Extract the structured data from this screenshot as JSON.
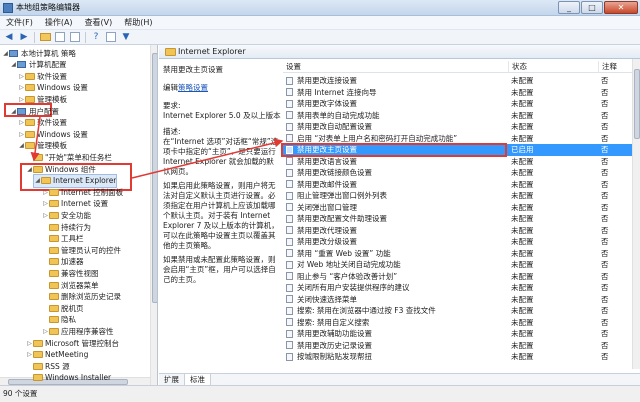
{
  "window": {
    "title": "本地组策略编辑器",
    "btn_min": "_",
    "btn_max": "□",
    "btn_close": "✕"
  },
  "menu": [
    "文件(F)",
    "操作(A)",
    "查看(V)",
    "帮助(H)"
  ],
  "toolbar_icons": [
    "back-arrow-icon",
    "forward-arrow-icon",
    "folder-icon",
    "view-icon",
    "properties-icon",
    "help-icon",
    "export-icon",
    "filter-icon"
  ],
  "tree": [
    {
      "label": "本地计算机 策略",
      "indent": 0,
      "twisty": "◢",
      "icon": "pc"
    },
    {
      "label": "计算机配置",
      "indent": 1,
      "twisty": "◢",
      "icon": "pc"
    },
    {
      "label": "软件设置",
      "indent": 2,
      "twisty": "▷",
      "icon": "folder"
    },
    {
      "label": "Windows 设置",
      "indent": 2,
      "twisty": "▷",
      "icon": "folder"
    },
    {
      "label": "管理模板",
      "indent": 2,
      "twisty": "▷",
      "icon": "folder"
    },
    {
      "label": "用户配置",
      "indent": 1,
      "twisty": "◢",
      "icon": "pc"
    },
    {
      "label": "软件设置",
      "indent": 2,
      "twisty": "▷",
      "icon": "folder"
    },
    {
      "label": "Windows 设置",
      "indent": 2,
      "twisty": "▷",
      "icon": "folder"
    },
    {
      "label": "管理模板",
      "indent": 2,
      "twisty": "◢",
      "icon": "folder"
    },
    {
      "label": "\"开始\"菜单和任务栏",
      "indent": 3,
      "twisty": "",
      "icon": "folder"
    },
    {
      "label": "Windows 组件",
      "indent": 3,
      "twisty": "◢",
      "icon": "folder"
    },
    {
      "label": "Internet Explorer",
      "indent": 4,
      "twisty": "◢",
      "icon": "folder"
    },
    {
      "label": "Internet 控制面板",
      "indent": 5,
      "twisty": "▷",
      "icon": "folder"
    },
    {
      "label": "Internet 设置",
      "indent": 5,
      "twisty": "▷",
      "icon": "folder"
    },
    {
      "label": "安全功能",
      "indent": 5,
      "twisty": "▷",
      "icon": "folder"
    },
    {
      "label": "持续行为",
      "indent": 5,
      "twisty": "",
      "icon": "folder"
    },
    {
      "label": "工具栏",
      "indent": 5,
      "twisty": "",
      "icon": "folder"
    },
    {
      "label": "管理员认可的控件",
      "indent": 5,
      "twisty": "",
      "icon": "folder"
    },
    {
      "label": "加速器",
      "indent": 5,
      "twisty": "",
      "icon": "folder"
    },
    {
      "label": "兼容性视图",
      "indent": 5,
      "twisty": "",
      "icon": "folder"
    },
    {
      "label": "浏览器菜单",
      "indent": 5,
      "twisty": "",
      "icon": "folder"
    },
    {
      "label": "删除浏览历史记录",
      "indent": 5,
      "twisty": "",
      "icon": "folder"
    },
    {
      "label": "脱机页",
      "indent": 5,
      "twisty": "",
      "icon": "folder"
    },
    {
      "label": "隐私",
      "indent": 5,
      "twisty": "",
      "icon": "folder"
    },
    {
      "label": "应用程序兼容性",
      "indent": 5,
      "twisty": "▷",
      "icon": "folder"
    },
    {
      "label": "Microsoft 管理控制台",
      "indent": 3,
      "twisty": "▷",
      "icon": "folder"
    },
    {
      "label": "NetMeeting",
      "indent": 3,
      "twisty": "▷",
      "icon": "folder"
    },
    {
      "label": "RSS 源",
      "indent": 3,
      "twisty": "",
      "icon": "folder"
    },
    {
      "label": "Windows Installer",
      "indent": 3,
      "twisty": "",
      "icon": "folder"
    }
  ],
  "right_header": "Internet Explorer",
  "description": {
    "title": "禁用更改主页设置",
    "edit_prefix": "编辑",
    "edit_link": "策略设置",
    "req_label": "要求:",
    "req_text": "Internet Explorer 5.0 及以上版本",
    "desc_label": "描述:",
    "desc_text": "在“Internet 选项”对话框“常规”选项卡中指定的“主页”，是只要运行 Internet Explorer 就会加载的默认网页。",
    "p2": "如果启用此策略设置，则用户将无法对自定义默认主页进行设置。必须指定在用户计算机上应该加载哪个默认主页。对于装有 Internet Explorer 7 及以上版本的计算机，可以在此策略中设置主页以覆盖其他的主页策略。",
    "p3": "如果禁用或未配置此策略设置，则会启用“主页”框，用户可以选择自己的主页。"
  },
  "list_headers": {
    "setting": "设置",
    "state": "状态",
    "comment": "注释"
  },
  "settings": [
    {
      "name": "禁用更改连接设置",
      "state": "未配置",
      "comment": "否"
    },
    {
      "name": "禁用 Internet 连接向导",
      "state": "未配置",
      "comment": "否"
    },
    {
      "name": "禁用更改字体设置",
      "state": "未配置",
      "comment": "否"
    },
    {
      "name": "禁用表单的自动完成功能",
      "state": "未配置",
      "comment": "否"
    },
    {
      "name": "禁用更改自动配置设置",
      "state": "未配置",
      "comment": "否"
    },
    {
      "name": "启用 “对表单上用户名和密码打开自动完成功能”",
      "state": "未配置",
      "comment": "否"
    },
    {
      "name": "禁用更改主页设置",
      "state": "已启用",
      "comment": "否"
    },
    {
      "name": "禁用更改语言设置",
      "state": "未配置",
      "comment": "否"
    },
    {
      "name": "禁用更改链接颜色设置",
      "state": "未配置",
      "comment": "否"
    },
    {
      "name": "禁用更改邮件设置",
      "state": "未配置",
      "comment": "否"
    },
    {
      "name": "阻止管理弹出窗口例外列表",
      "state": "未配置",
      "comment": "否"
    },
    {
      "name": "关闭弹出窗口管理",
      "state": "未配置",
      "comment": "否"
    },
    {
      "name": "禁用更改配置文件助理设置",
      "state": "未配置",
      "comment": "否"
    },
    {
      "name": "禁用更改代理设置",
      "state": "未配置",
      "comment": "否"
    },
    {
      "name": "禁用更改分级设置",
      "state": "未配置",
      "comment": "否"
    },
    {
      "name": "禁用 “重置 Web 设置” 功能",
      "state": "未配置",
      "comment": "否"
    },
    {
      "name": "对 Web 地址关闭自动完成功能",
      "state": "未配置",
      "comment": "否"
    },
    {
      "name": "阻止参与 “客户体验改善计划”",
      "state": "未配置",
      "comment": "否"
    },
    {
      "name": "关闭所有用户安装提供程序的建议",
      "state": "未配置",
      "comment": "否"
    },
    {
      "name": "关闭快速选择菜单",
      "state": "未配置",
      "comment": "否"
    },
    {
      "name": "搜索: 禁用在浏览器中通过按 F3 查找文件",
      "state": "未配置",
      "comment": "否"
    },
    {
      "name": "搜索: 禁用自定义搜索",
      "state": "未配置",
      "comment": "否"
    },
    {
      "name": "禁用更改辅助功能设置",
      "state": "未配置",
      "comment": "否"
    },
    {
      "name": "禁用更改历史记录设置",
      "state": "未配置",
      "comment": "否"
    },
    {
      "name": "按城限制粘贴发现帮扭",
      "state": "未配置",
      "comment": "否"
    }
  ],
  "tabs": [
    "扩展",
    "标准"
  ],
  "status": "90 个设置",
  "colors": {
    "selection": "#3399ff",
    "annotation": "#e03a33"
  }
}
